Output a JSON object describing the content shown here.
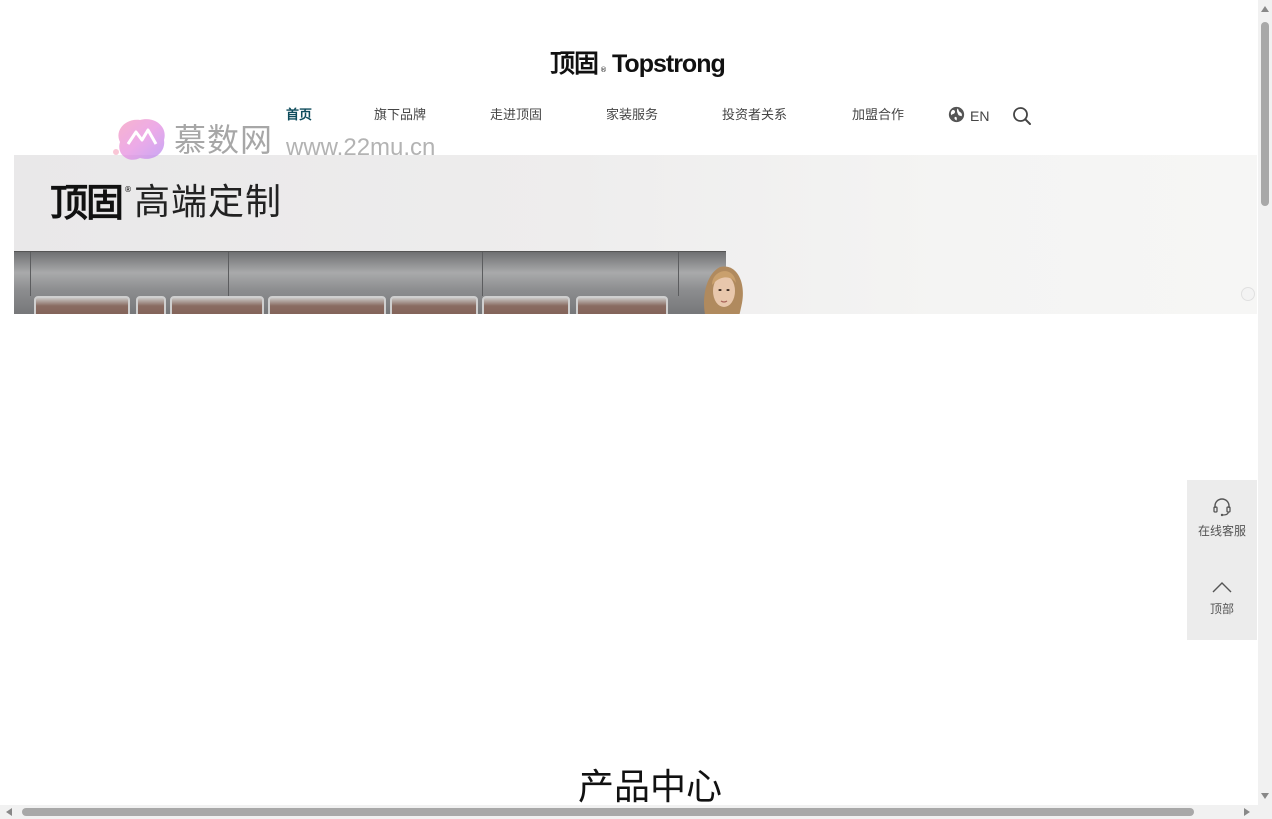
{
  "header": {
    "logo_cn": "顶固",
    "logo_reg": "®",
    "logo_en": "Topstrong"
  },
  "nav": {
    "items": [
      {
        "label": "首页",
        "active": true
      },
      {
        "label": "旗下品牌",
        "active": false
      },
      {
        "label": "走进顶固",
        "active": false
      },
      {
        "label": "家装服务",
        "active": false
      },
      {
        "label": "投资者关系",
        "active": false
      },
      {
        "label": "加盟合作",
        "active": false
      }
    ],
    "lang_label": "EN",
    "lang_icon": "globe-icon",
    "search_icon": "search-icon",
    "active_color": "#0f4c5c"
  },
  "watermark": {
    "name": "慕数网",
    "url": "www.22mu.cn"
  },
  "banner": {
    "brand": "顶固",
    "reg": "®",
    "subtitle": "高端定制"
  },
  "section": {
    "title": "产品中心"
  },
  "side_panel": {
    "service_label": "在线客服",
    "service_icon": "headset-icon",
    "top_label": "顶部",
    "top_icon": "chevron-up-icon"
  }
}
